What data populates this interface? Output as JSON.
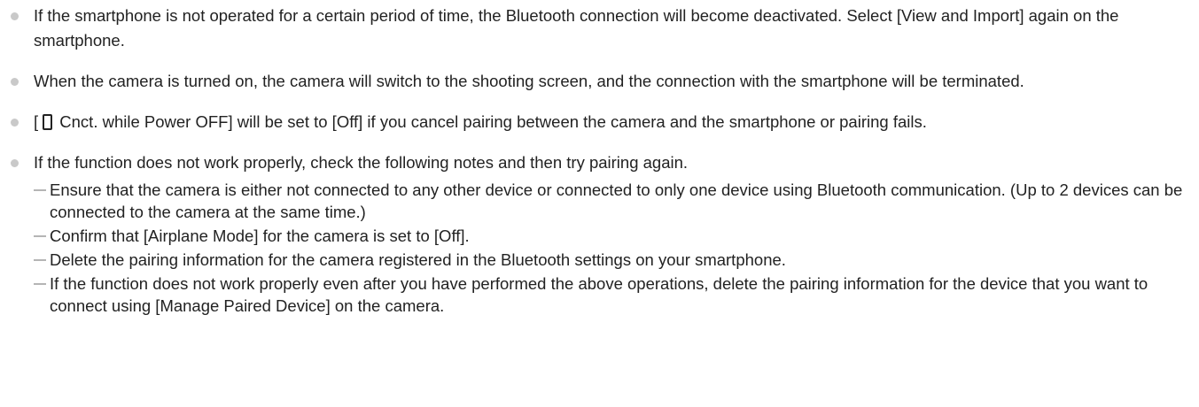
{
  "notes": [
    {
      "text": "If the smartphone is not operated for a certain period of time, the Bluetooth connection will become deactivated. Select [View and Import] again on the smartphone."
    },
    {
      "text": "When the camera is turned on, the camera will switch to the shooting screen, and the connection with the smartphone will be terminated."
    },
    {
      "prefix": "[",
      "icon": "smartphone-icon",
      "suffix": " Cnct. while Power OFF] will be set to [Off] if you cancel pairing between the camera and the smartphone or pairing fails."
    },
    {
      "text": "If the function does not work properly, check the following notes and then try pairing again.",
      "subitems": [
        "Ensure that the camera is either not connected to any other device or connected to only one device using Bluetooth communication. (Up to 2 devices can be connected to the camera at the same time.)",
        "Confirm that [Airplane Mode] for the camera is set to [Off].",
        "Delete the pairing information for the camera registered in the Bluetooth settings on your smartphone.",
        "If the function does not work properly even after you have performed the above operations, delete the pairing information for the device that you want to connect using [Manage Paired Device] on the camera."
      ]
    }
  ]
}
